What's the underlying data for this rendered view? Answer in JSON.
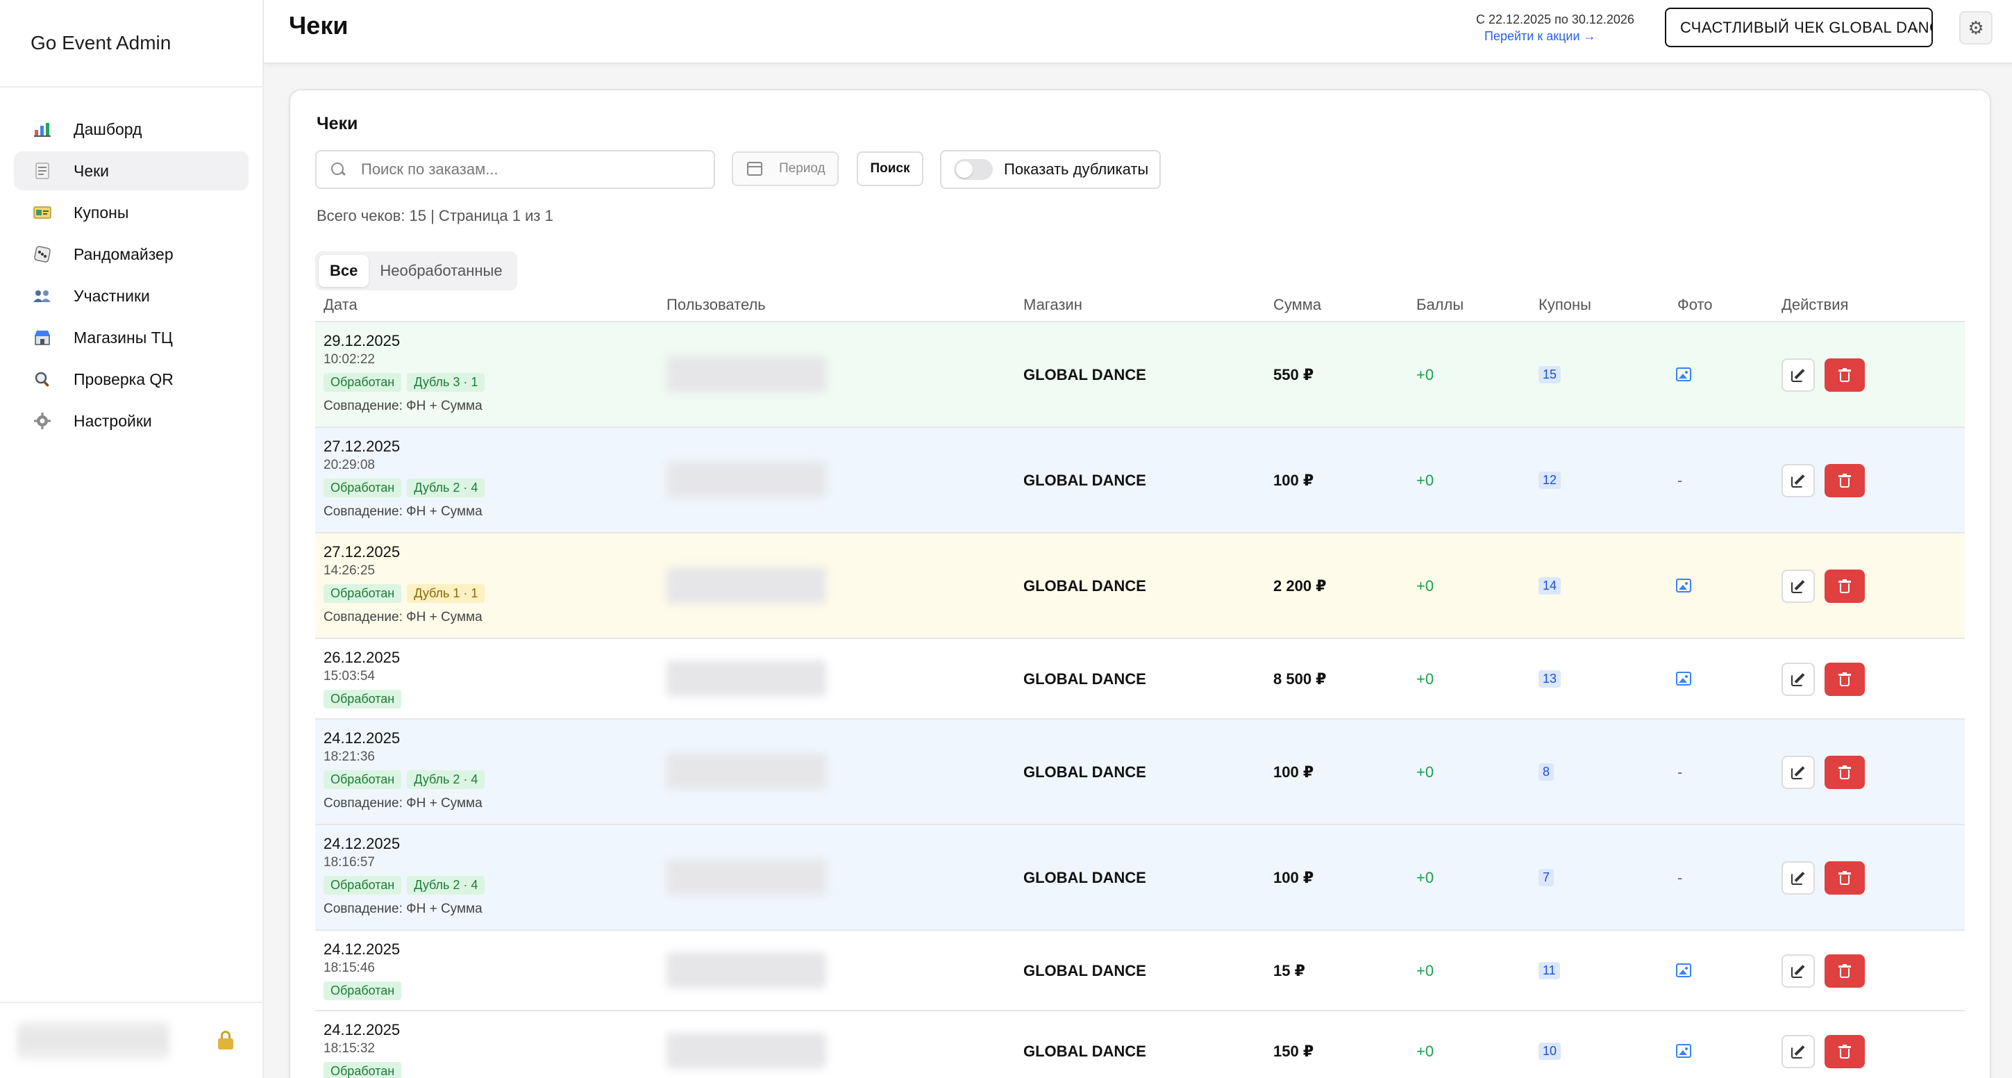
{
  "app": {
    "brand": "Go Event Admin"
  },
  "sidebar": {
    "items": [
      {
        "label": "Дашборд",
        "icon": "bar-chart-icon",
        "active": false
      },
      {
        "label": "Чеки",
        "icon": "receipt-icon",
        "active": true
      },
      {
        "label": "Купоны",
        "icon": "ticket-icon",
        "active": false
      },
      {
        "label": "Рандомайзер",
        "icon": "dice-icon",
        "active": false
      },
      {
        "label": "Участники",
        "icon": "users-icon",
        "active": false
      },
      {
        "label": "Магазины ТЦ",
        "icon": "store-icon",
        "active": false
      },
      {
        "label": "Проверка QR",
        "icon": "magnifier-icon",
        "active": false
      },
      {
        "label": "Настройки",
        "icon": "gear-icon",
        "active": false
      }
    ]
  },
  "header": {
    "title": "Чеки",
    "promo_dates": "С 22.12.2025 по 30.12.2026",
    "promo_link": "Перейти к акции →",
    "promo_select": "СЧАСТЛИВЫЙ ЧЕК GLOBAL DANCE"
  },
  "card": {
    "title": "Чеки",
    "search_placeholder": "Поиск по заказам...",
    "period_label": "Период",
    "search_button": "Поиск",
    "duplicates_label": "Показать дубликаты",
    "summary": "Всего чеков: 15 | Страница 1 из 1",
    "tabs": [
      {
        "label": "Все",
        "active": true
      },
      {
        "label": "Необработанные",
        "active": false
      }
    ]
  },
  "table": {
    "headers": {
      "date": "Дата",
      "user": "Пользователь",
      "shop": "Магазин",
      "sum": "Сумма",
      "points": "Баллы",
      "coupons": "Купоны",
      "photo": "Фото",
      "actions": "Действия"
    },
    "rows": [
      {
        "date": "29.12.2025",
        "time": "10:02:22",
        "status": "Обработан",
        "dup": "Дубль 3 · 1",
        "dup_warn": false,
        "match": "Совпадение: ФН + Сумма",
        "shop": "GLOBAL DANCE",
        "sum": "550 ₽",
        "points": "+0",
        "coupons": "15",
        "photo": true,
        "tone": "green"
      },
      {
        "date": "27.12.2025",
        "time": "20:29:08",
        "status": "Обработан",
        "dup": "Дубль 2 · 4",
        "dup_warn": false,
        "match": "Совпадение: ФН + Сумма",
        "shop": "GLOBAL DANCE",
        "sum": "100 ₽",
        "points": "+0",
        "coupons": "12",
        "photo": false,
        "tone": "blue"
      },
      {
        "date": "27.12.2025",
        "time": "14:26:25",
        "status": "Обработан",
        "dup": "Дубль 1 · 1",
        "dup_warn": true,
        "match": "Совпадение: ФН + Сумма",
        "shop": "GLOBAL DANCE",
        "sum": "2 200 ₽",
        "points": "+0",
        "coupons": "14",
        "photo": true,
        "tone": "yellow"
      },
      {
        "date": "26.12.2025",
        "time": "15:03:54",
        "status": "Обработан",
        "dup": "",
        "dup_warn": false,
        "match": "",
        "shop": "GLOBAL DANCE",
        "sum": "8 500 ₽",
        "points": "+0",
        "coupons": "13",
        "photo": true,
        "tone": "white"
      },
      {
        "date": "24.12.2025",
        "time": "18:21:36",
        "status": "Обработан",
        "dup": "Дубль 2 · 4",
        "dup_warn": false,
        "match": "Совпадение: ФН + Сумма",
        "shop": "GLOBAL DANCE",
        "sum": "100 ₽",
        "points": "+0",
        "coupons": "8",
        "photo": false,
        "tone": "blue"
      },
      {
        "date": "24.12.2025",
        "time": "18:16:57",
        "status": "Обработан",
        "dup": "Дубль 2 · 4",
        "dup_warn": false,
        "match": "Совпадение: ФН + Сумма",
        "shop": "GLOBAL DANCE",
        "sum": "100 ₽",
        "points": "+0",
        "coupons": "7",
        "photo": false,
        "tone": "blue"
      },
      {
        "date": "24.12.2025",
        "time": "18:15:46",
        "status": "Обработан",
        "dup": "",
        "dup_warn": false,
        "match": "",
        "shop": "GLOBAL DANCE",
        "sum": "15 ₽",
        "points": "+0",
        "coupons": "11",
        "photo": true,
        "tone": "white"
      },
      {
        "date": "24.12.2025",
        "time": "18:15:32",
        "status": "Обработан",
        "dup": "",
        "dup_warn": false,
        "match": "",
        "shop": "GLOBAL DANCE",
        "sum": "150 ₽",
        "points": "+0",
        "coupons": "10",
        "photo": true,
        "tone": "white"
      }
    ],
    "no_photo": "-"
  },
  "colors": {
    "accent_link": "#2563eb",
    "delete": "#e0403f",
    "points": "#16a34a"
  }
}
